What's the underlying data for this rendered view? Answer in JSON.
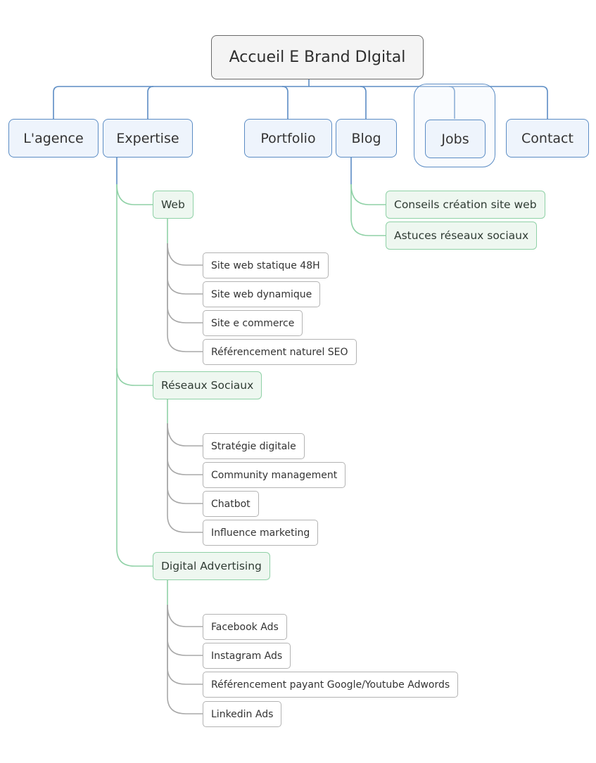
{
  "title": "Accueil E Brand DIgital",
  "colors": {
    "main_line": "#5b8cc4",
    "sub_line": "#8fd1a6",
    "leaf_line": "#a8a8a8"
  },
  "main_topics": [
    {
      "label": "L'agence"
    },
    {
      "label": "Expertise"
    },
    {
      "label": "Portfolio"
    },
    {
      "label": "Blog"
    },
    {
      "label": "Jobs",
      "boundary": true
    },
    {
      "label": "Contact"
    }
  ],
  "expertise": [
    {
      "label": "Web",
      "children": [
        "Site web statique 48H",
        "Site web dynamique",
        "Site e commerce",
        "Référencement naturel SEO"
      ]
    },
    {
      "label": "Réseaux Sociaux",
      "children": [
        "Stratégie digitale",
        "Community management",
        "Chatbot",
        "Influence marketing"
      ]
    },
    {
      "label": "Digital Advertising",
      "children": [
        "Facebook Ads",
        "Instagram Ads",
        "Référencement payant Google/Youtube Adwords",
        "Linkedin Ads"
      ]
    }
  ],
  "blog": [
    "Conseils création site web",
    "Astuces réseaux sociaux"
  ]
}
